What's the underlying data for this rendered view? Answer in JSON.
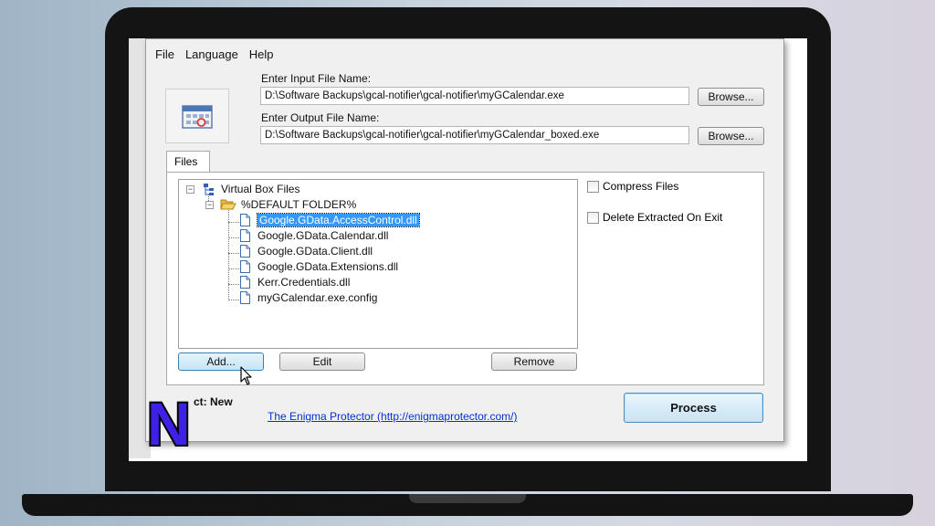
{
  "menu": [
    "File",
    "Language",
    "Help"
  ],
  "input_file": {
    "label": "Enter Input File Name:",
    "value": "D:\\Software Backups\\gcal-notifier\\gcal-notifier\\myGCalendar.exe",
    "browse_label": "Browse..."
  },
  "output_file": {
    "label": "Enter Output File Name:",
    "value": "D:\\Software Backups\\gcal-notifier\\gcal-notifier\\myGCalendar_boxed.exe",
    "browse_label": "Browse..."
  },
  "tab_label": "Files",
  "tree": {
    "root": "Virtual Box Files",
    "folder": "%DEFAULT FOLDER%",
    "files": [
      "Google.GData.AccessControl.dll",
      "Google.GData.Calendar.dll",
      "Google.GData.Client.dll",
      "Google.GData.Extensions.dll",
      "Kerr.Credentials.dll",
      "myGCalendar.exe.config"
    ],
    "selected_index": 0
  },
  "options": {
    "compress_files": "Compress Files",
    "delete_extracted": "Delete Extracted On Exit"
  },
  "buttons": {
    "add": "Add...",
    "edit": "Edit",
    "remove": "Remove",
    "process": "Process"
  },
  "project_text": "ct: New",
  "link_text": "The Enigma Protector (http://enigmaprotector.com/)",
  "logo_letter": "N",
  "colors": {
    "selection": "#3399ff",
    "link": "#0033cc",
    "logo_fill": "#3d22e6",
    "logo_outline": "#000000"
  }
}
